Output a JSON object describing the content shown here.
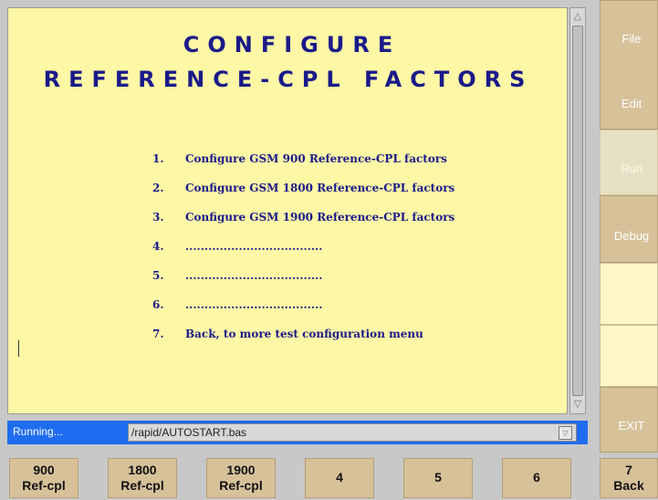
{
  "title_line1": "CONFIGURE",
  "title_line2": "REFERENCE-CPL FACTORS",
  "menu": [
    {
      "num": "1.",
      "text": "Configure GSM 900 Reference-CPL factors"
    },
    {
      "num": "2.",
      "text": "Configure GSM 1800 Reference-CPL factors"
    },
    {
      "num": "3.",
      "text": "Configure GSM 1900 Reference-CPL factors"
    },
    {
      "num": "4.",
      "text": "...................................."
    },
    {
      "num": "5.",
      "text": "...................................."
    },
    {
      "num": "6.",
      "text": "...................................."
    },
    {
      "num": "7.",
      "text": "Back, to more test configuration menu"
    }
  ],
  "sidebar": {
    "file": "File",
    "edit": "Edit",
    "run": "Run",
    "debug": "Debug",
    "exit": "EXIT"
  },
  "status": {
    "label": "Running...",
    "path": "/rapid/AUTOSTART.bas"
  },
  "softkeys": [
    {
      "l1": "900",
      "l2": "Ref-cpl"
    },
    {
      "l1": "1800",
      "l2": "Ref-cpl"
    },
    {
      "l1": "1900",
      "l2": "Ref-cpl"
    },
    {
      "l1": "4",
      "l2": ""
    },
    {
      "l1": "5",
      "l2": ""
    },
    {
      "l1": "6",
      "l2": ""
    },
    {
      "l1": "7",
      "l2": "Back"
    }
  ],
  "icons": {
    "scroll_up": "triangle-up-icon",
    "scroll_down": "triangle-down-icon",
    "dropdown": "triangle-down-icon"
  }
}
